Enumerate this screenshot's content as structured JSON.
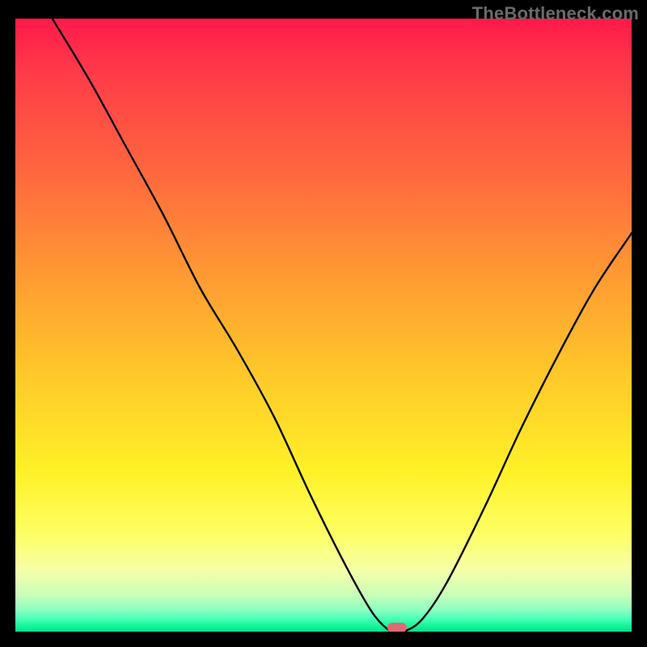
{
  "watermark": "TheBottleneck.com",
  "chart_data": {
    "type": "line",
    "title": "",
    "xlabel": "",
    "ylabel": "",
    "xlim": [
      0,
      100
    ],
    "ylim": [
      0,
      100
    ],
    "series": [
      {
        "name": "curve",
        "x": [
          0,
          6,
          12,
          18,
          24,
          30,
          36,
          42,
          48,
          54,
          58,
          61,
          63,
          66,
          70,
          76,
          82,
          88,
          94,
          100
        ],
        "values": [
          110,
          100,
          90,
          79,
          68,
          56,
          46,
          35,
          22,
          10,
          3,
          0,
          0,
          2,
          8,
          20,
          33,
          45,
          56,
          65
        ]
      }
    ],
    "marker": {
      "x": 62,
      "y": 0
    },
    "gradient_stops": [
      {
        "pct": 0,
        "color": "#ff1a4b"
      },
      {
        "pct": 8,
        "color": "#ff3849"
      },
      {
        "pct": 26,
        "color": "#ff6a3e"
      },
      {
        "pct": 42,
        "color": "#ff9a33"
      },
      {
        "pct": 58,
        "color": "#ffc829"
      },
      {
        "pct": 74,
        "color": "#fff128"
      },
      {
        "pct": 84,
        "color": "#fdff63"
      },
      {
        "pct": 90,
        "color": "#f6ffa8"
      },
      {
        "pct": 94,
        "color": "#c8ffb8"
      },
      {
        "pct": 96.5,
        "color": "#8bffc0"
      },
      {
        "pct": 98,
        "color": "#44ffb6"
      },
      {
        "pct": 99,
        "color": "#18f59a"
      },
      {
        "pct": 100,
        "color": "#00e28a"
      }
    ]
  }
}
